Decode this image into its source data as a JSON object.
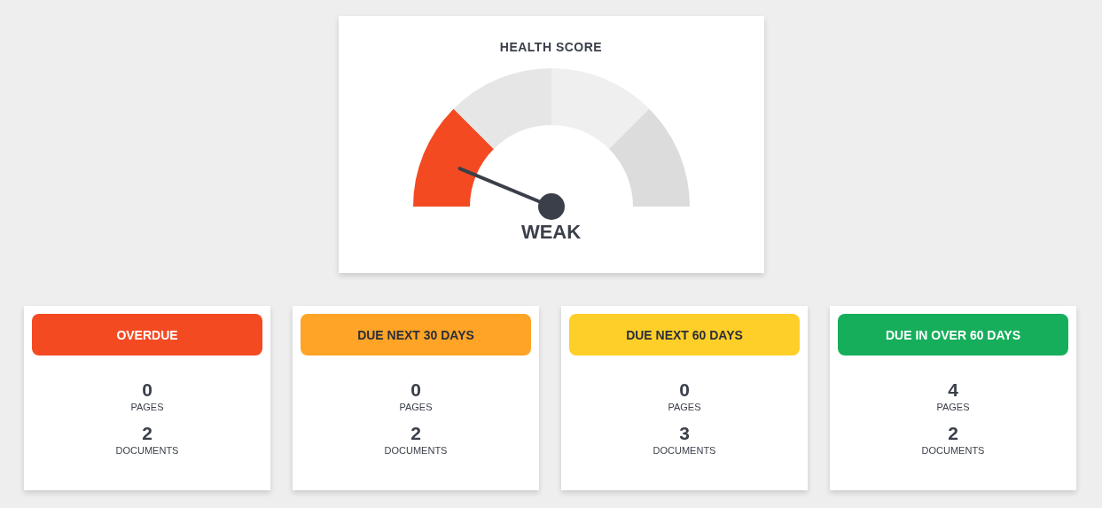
{
  "health_score": {
    "title": "HEALTH SCORE",
    "gauge": {
      "segments": [
        {
          "selected": true
        },
        {
          "selected": false
        },
        {
          "selected": false
        },
        {
          "selected": false
        }
      ]
    },
    "rating": "WEAK"
  },
  "cards": [
    {
      "title": "OVERDUE",
      "color": "#f44a22",
      "stats": [
        {
          "value": "0",
          "label": "PAGES"
        },
        {
          "value": "2",
          "label": "DOCUMENTS"
        }
      ]
    },
    {
      "title": "DUE NEXT 30 DAYS",
      "color": "#ffa426",
      "stats": [
        {
          "value": "0",
          "label": "PAGES"
        },
        {
          "value": "2",
          "label": "DOCUMENTS"
        }
      ]
    },
    {
      "title": "DUE NEXT 60 DAYS",
      "color": "#ffcf29",
      "stats": [
        {
          "value": "0",
          "label": "PAGES"
        },
        {
          "value": "3",
          "label": "DOCUMENTS"
        }
      ]
    },
    {
      "title": "DUE IN OVER 60 DAYS",
      "color": "#16ae5b",
      "stats": [
        {
          "value": "4",
          "label": "PAGES"
        },
        {
          "value": "2",
          "label": "DOCUMENTS"
        }
      ]
    }
  ]
}
